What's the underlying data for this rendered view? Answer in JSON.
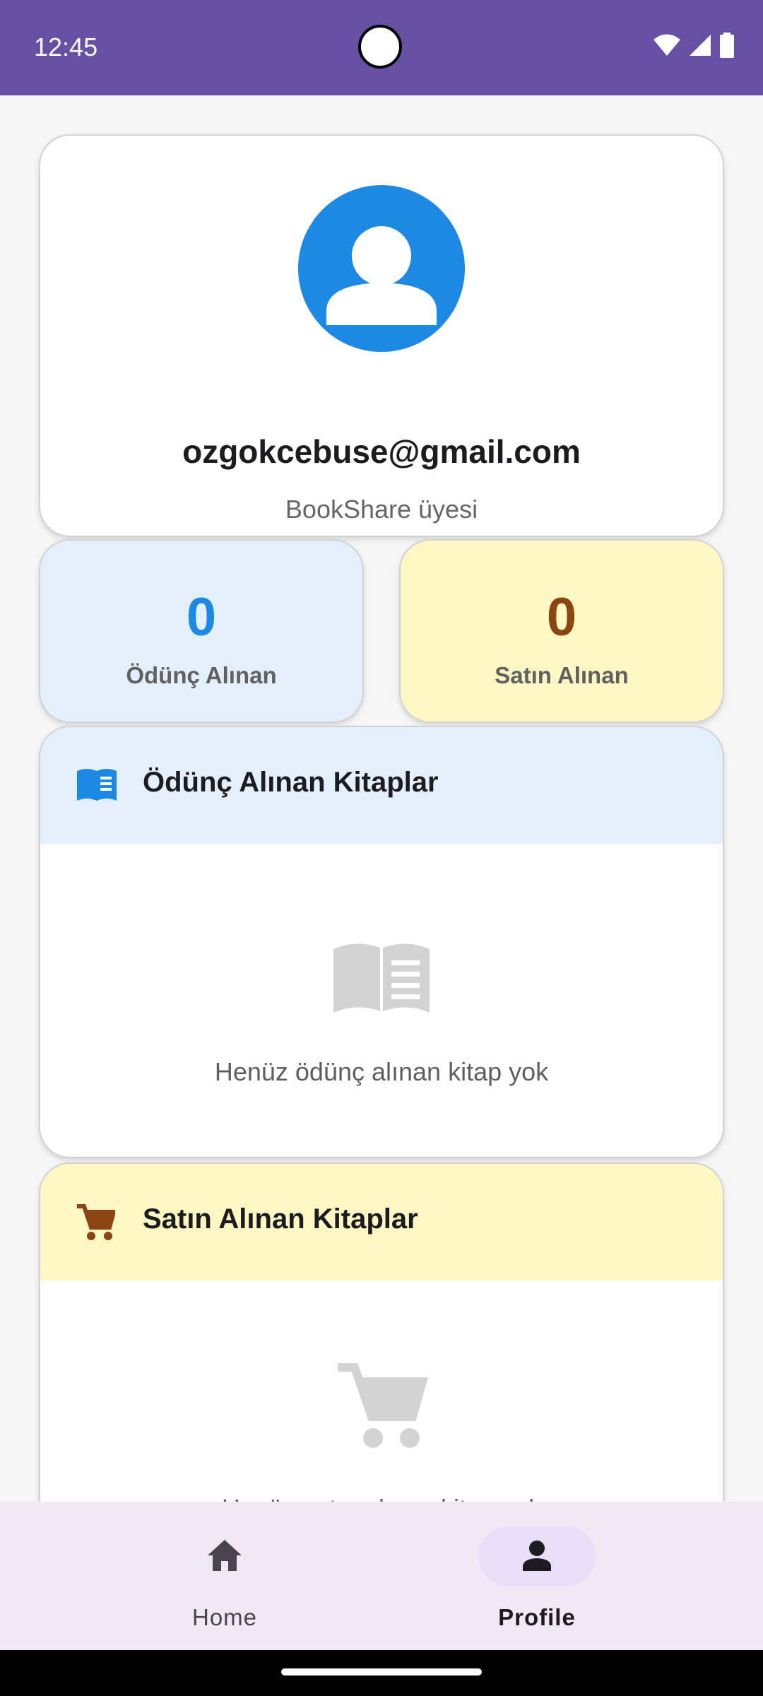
{
  "status_bar": {
    "time": "12:45",
    "icons": [
      "wifi-icon",
      "signal-icon",
      "battery-icon"
    ]
  },
  "profile": {
    "avatar_icon": "person-icon",
    "email": "ozgokcebuse@gmail.com",
    "subtitle": "BookShare üyesi"
  },
  "stats": {
    "borrowed": {
      "count": "0",
      "label": "Ödünç Alınan",
      "color": "#1e88e5"
    },
    "bought": {
      "count": "0",
      "label": "Satın Alınan",
      "color": "#8b4513"
    }
  },
  "sections": {
    "borrowed": {
      "icon": "open-book-icon",
      "title": "Ödünç Alınan Kitaplar",
      "empty_text": "Henüz ödünç alınan kitap yok"
    },
    "bought": {
      "icon": "cart-icon",
      "title": "Satın Alınan Kitaplar",
      "empty_text": "Henüz satın alınan kitap yok"
    }
  },
  "bottom_nav": {
    "items": [
      {
        "label": "Home",
        "icon": "home-icon",
        "selected": false
      },
      {
        "label": "Profile",
        "icon": "person-icon",
        "selected": true
      }
    ]
  },
  "colors": {
    "primary": "#6750a4",
    "blue": "#1e88e5",
    "brown": "#8b4513",
    "blue_light": "#e3f0fc",
    "yellow_light": "#fdf8c3"
  }
}
